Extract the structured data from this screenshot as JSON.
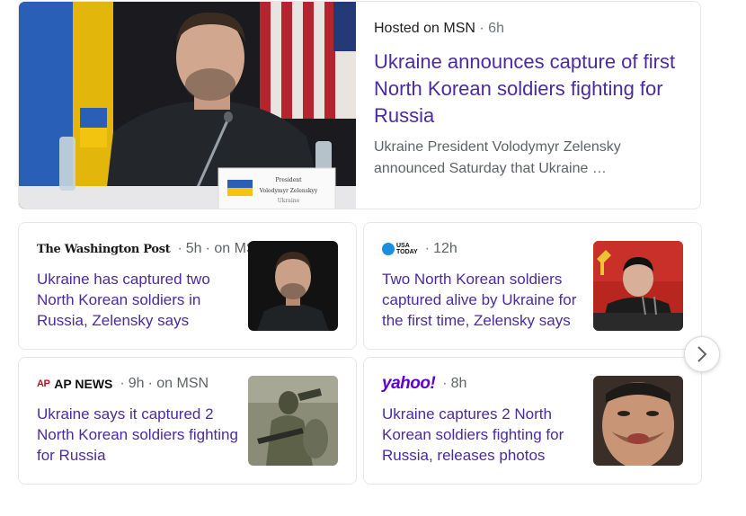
{
  "top_story": {
    "source": "Hosted on MSN",
    "separator": "·",
    "age": "6h",
    "title": "Ukraine announces capture of first North Korean soldiers fighting for Russia",
    "snippet": "Ukraine President Volodymyr Zelensky announced Saturday that Ukraine …",
    "image_placard_line1": "President",
    "image_placard_line2": "Volodymyr Zelenskyy",
    "image_placard_line3": "Ukraine"
  },
  "stories": [
    {
      "publisher": "The Washington Post",
      "separator": "·",
      "age": "5h",
      "via": "· on MSN",
      "title": "Ukraine has captured two North Korean soldiers in Russia, Zelensky says",
      "thumb_icon": "portrait-photo"
    },
    {
      "publisher": "USA TODAY",
      "publisher_line1": "USA",
      "publisher_line2": "TODAY",
      "separator": "·",
      "age": "12h",
      "title": "Two North Korean soldiers captured alive by Ukraine for the first time, Zelensky says",
      "thumb_icon": "speech-photo"
    },
    {
      "publisher": "AP NEWS",
      "publisher_ap": "AP",
      "publisher_news": "AP NEWS",
      "separator": "·",
      "age": "9h",
      "via": "· on MSN",
      "title": "Ukraine says it captured 2 North Korean soldiers fighting for Russia",
      "thumb_icon": "soldier-photo"
    },
    {
      "publisher": "yahoo!",
      "separator": "·",
      "age": "8h",
      "title": "Ukraine captures 2 North Korean soldiers fighting for Russia, releases photos",
      "thumb_icon": "face-photo"
    }
  ],
  "colors": {
    "title": "#4c2aa0",
    "snippet": "#5f6368",
    "border": "#e6e7ea",
    "yahoo": "#6001d2",
    "usa_today": "#1a8fe0",
    "ap_red": "#b8121b"
  },
  "next_icon": "chevron-right-icon"
}
